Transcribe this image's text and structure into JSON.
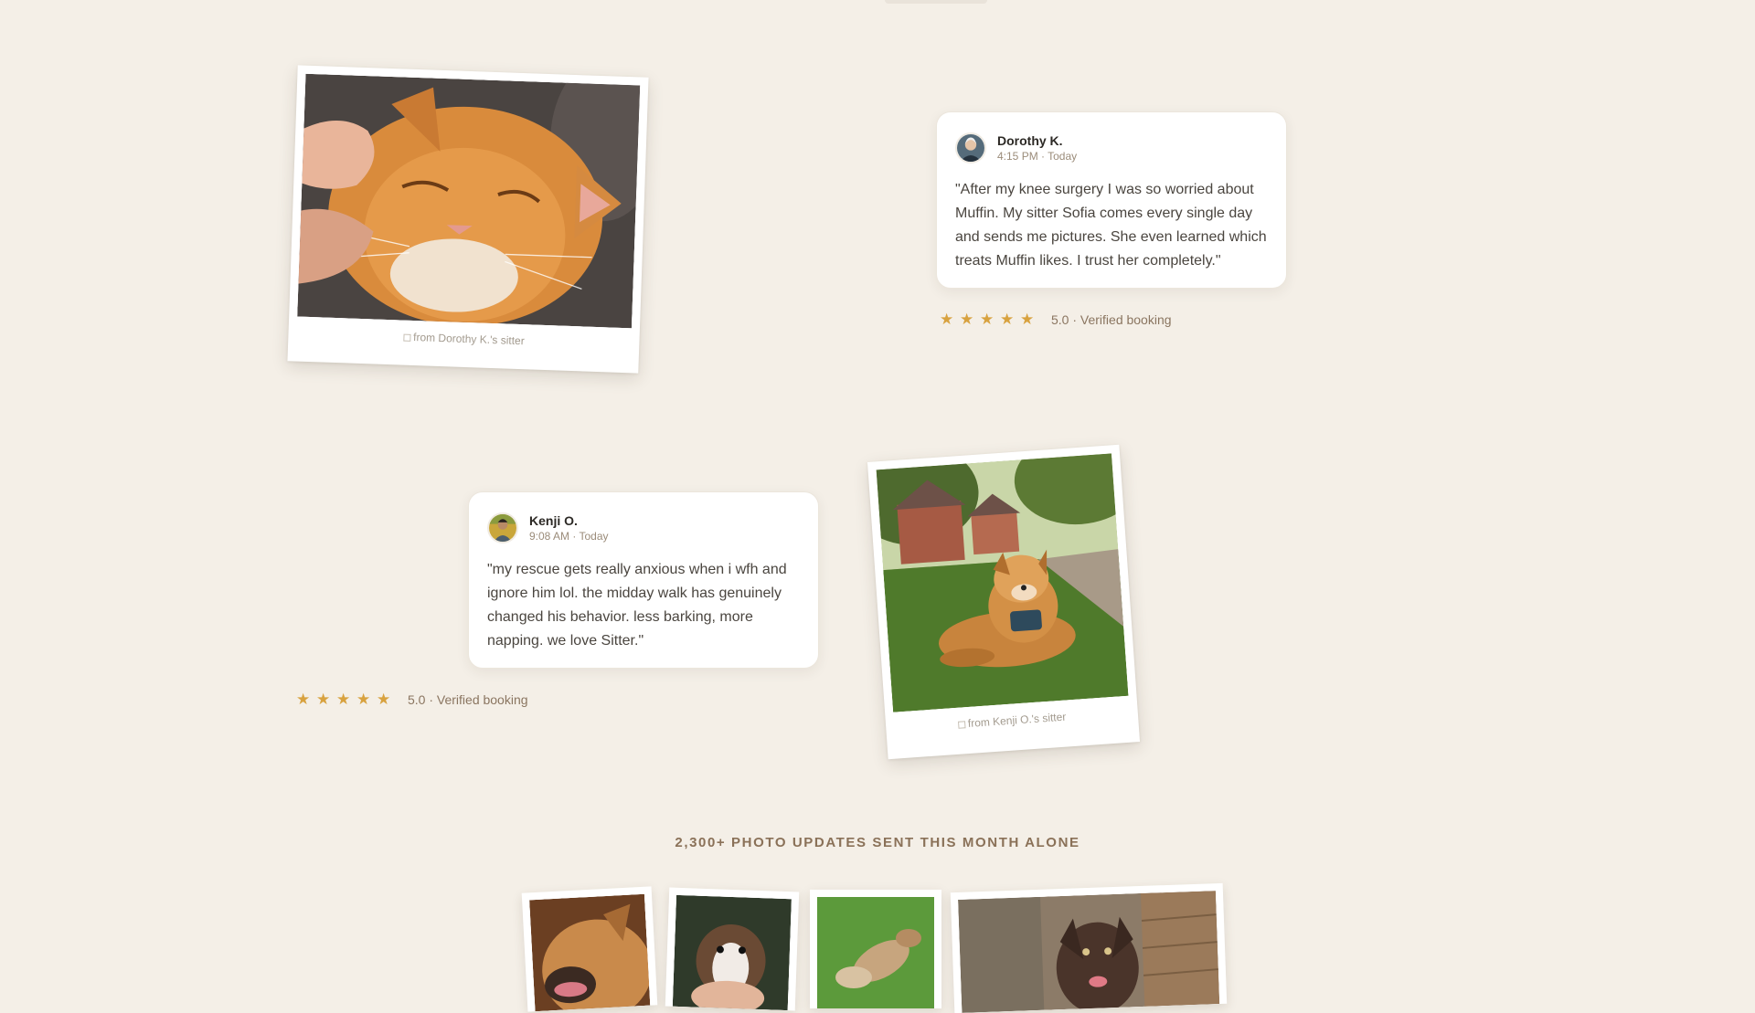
{
  "testimonials": [
    {
      "name": "Dorothy K.",
      "time": "4:15 PM · Today",
      "quote": "\"After my knee surgery I was so worried about Muffin. My sitter Sofia comes every single day and sends me pictures. She even learned which treats Muffin likes. I trust her completely.\"",
      "rating_text": "5.0 · Verified booking",
      "stars": 5,
      "photo_caption": "from Dorothy K.'s sitter",
      "photo_icon": "cat-photo"
    },
    {
      "name": "Kenji O.",
      "time": "9:08 AM · Today",
      "quote": "\"my rescue gets really anxious when i wfh and ignore him lol. the midday walk has genuinely changed his behavior. less barking, more napping. we love Sitter.\"",
      "rating_text": "5.0 · Verified booking",
      "stars": 5,
      "photo_caption": "from Kenji O.'s sitter",
      "photo_icon": "dog-photo"
    }
  ],
  "gallery": {
    "label": "2,300+ PHOTO UPDATES SENT THIS MONTH ALONE"
  },
  "colors": {
    "background": "#f4efe7",
    "star": "#d8a23f",
    "label": "#8a7158"
  }
}
